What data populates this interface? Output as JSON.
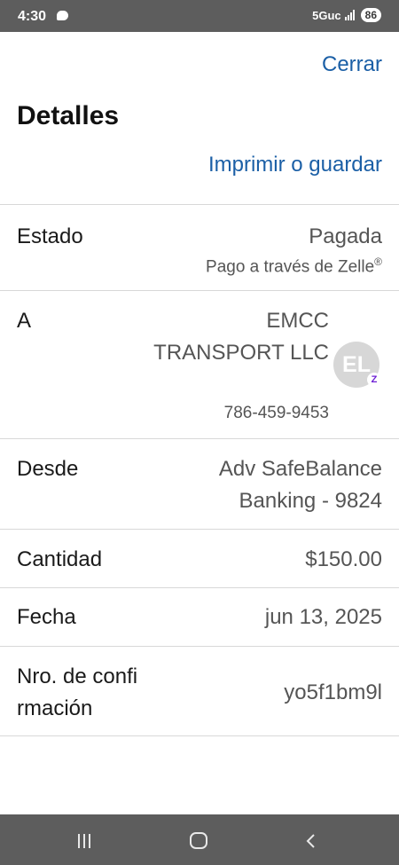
{
  "status_bar": {
    "time": "4:30",
    "network": "5Guc",
    "battery": "86"
  },
  "header": {
    "close_label": "Cerrar",
    "title": "Detalles",
    "print_label": "Imprimir o guardar"
  },
  "details": {
    "status": {
      "label": "Estado",
      "value": "Pagada",
      "sub": "Pago a través de Zelle",
      "sub_mark": "®"
    },
    "recipient": {
      "label": "A",
      "name": "EMCC TRANSPORT LLC",
      "phone": "786-459-9453",
      "avatar_initials": "EL",
      "badge": "Z"
    },
    "from": {
      "label": "Desde",
      "line1": "Adv SafeBalance",
      "line2": "Banking - 9824"
    },
    "amount": {
      "label": "Cantidad",
      "value": "$150.00"
    },
    "date": {
      "label": "Fecha",
      "value": "jun 13, 2025"
    },
    "confirmation": {
      "label_line1": "Nro. de confi",
      "label_line2": "rmación",
      "value": "yo5f1bm9l"
    }
  },
  "colors": {
    "link": "#1b5fa6",
    "system_bar": "#5d5d5d",
    "zelle": "#6d1ed4"
  },
  "icons": {
    "status_message": "message-bubble-icon",
    "signal": "signal-bars-icon",
    "nav_recents": "recents-icon",
    "nav_home": "home-icon",
    "nav_back": "back-icon"
  }
}
